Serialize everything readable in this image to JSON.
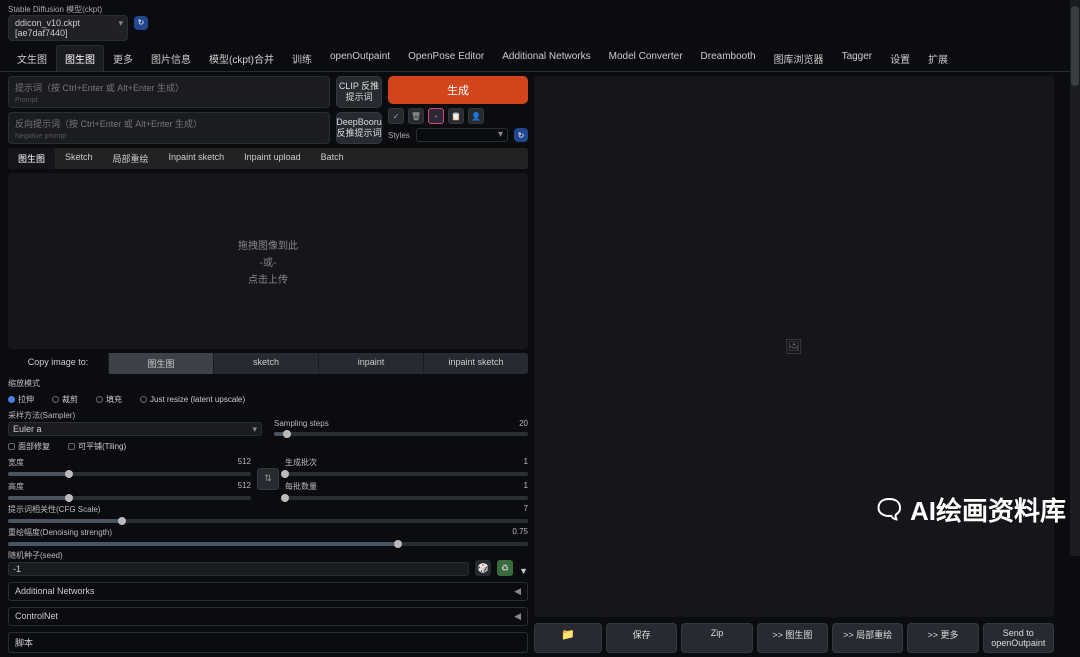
{
  "model": {
    "label": "Stable Diffusion 模型(ckpt)",
    "value": "ddicon_v10.ckpt [ae7daf7440]"
  },
  "nav": [
    "文生图",
    "图生图",
    "更多",
    "图片信息",
    "模型(ckpt)合并",
    "训练",
    "openOutpaint",
    "OpenPose Editor",
    "Additional Networks",
    "Model Converter",
    "Dreambooth",
    "图库浏览器",
    "Tagger",
    "设置",
    "扩展"
  ],
  "active_nav": 1,
  "prompt": {
    "placeholder": "提示词（按 Ctrl+Enter 或 Alt+Enter 生成）",
    "hint": "Prompt"
  },
  "neg": {
    "placeholder": "反向提示词（按 Ctrl+Enter 或 Alt+Enter 生成）",
    "hint": "Negative prompt"
  },
  "clip": "CLIP 反推提示词",
  "db": "DeepBooru 反推提示词",
  "generate": "生成",
  "styles_label": "Styles",
  "subtabs": [
    "图生图",
    "Sketch",
    "局部重绘",
    "Inpaint sketch",
    "Inpaint upload",
    "Batch"
  ],
  "drop": {
    "l1": "拖拽图像到此",
    "l2": "-或-",
    "l3": "点击上传"
  },
  "copy": {
    "label": "Copy image to:",
    "btns": [
      "图生图",
      "sketch",
      "inpaint",
      "inpaint sketch"
    ]
  },
  "resize": {
    "title": "缩放模式",
    "opts": [
      "拉伸",
      "裁剪",
      "填充",
      "Just resize (latent upscale)"
    ]
  },
  "sampler": {
    "label": "采样方法(Sampler)",
    "value": "Euler a"
  },
  "steps": {
    "label": "Sampling steps",
    "value": "20",
    "pct": 5
  },
  "checks": [
    "面部修复",
    "可平铺(Tiling)"
  ],
  "width": {
    "label": "宽度",
    "value": "512",
    "pct": 25
  },
  "height": {
    "label": "高度",
    "value": "512",
    "pct": 25
  },
  "batchcount": {
    "label": "生成批次",
    "value": "1",
    "pct": 0
  },
  "batchsize": {
    "label": "每批数量",
    "value": "1",
    "pct": 0
  },
  "cfg": {
    "label": "提示词相关性(CFG Scale)",
    "value": "7",
    "pct": 22
  },
  "denoise": {
    "label": "重绘幅度(Denoising strength)",
    "value": "0.75",
    "pct": 75
  },
  "seed": {
    "label": "随机种子(seed)",
    "value": "-1"
  },
  "accordions": [
    "Additional Networks",
    "ControlNet",
    "脚本"
  ],
  "result_btns": {
    "folder": "📁",
    "save": "保存",
    "zip": "Zip",
    "img2img": ">> 图生图",
    "inpaint": ">> 局部重绘",
    "more": ">> 更多",
    "send": "Send to openOutpaint"
  },
  "watermark": "AI绘画资料库",
  "swap": "⇅",
  "dice": "🎲",
  "recycle": "♻",
  "tri": "▼",
  "preview_icon": "🖼"
}
